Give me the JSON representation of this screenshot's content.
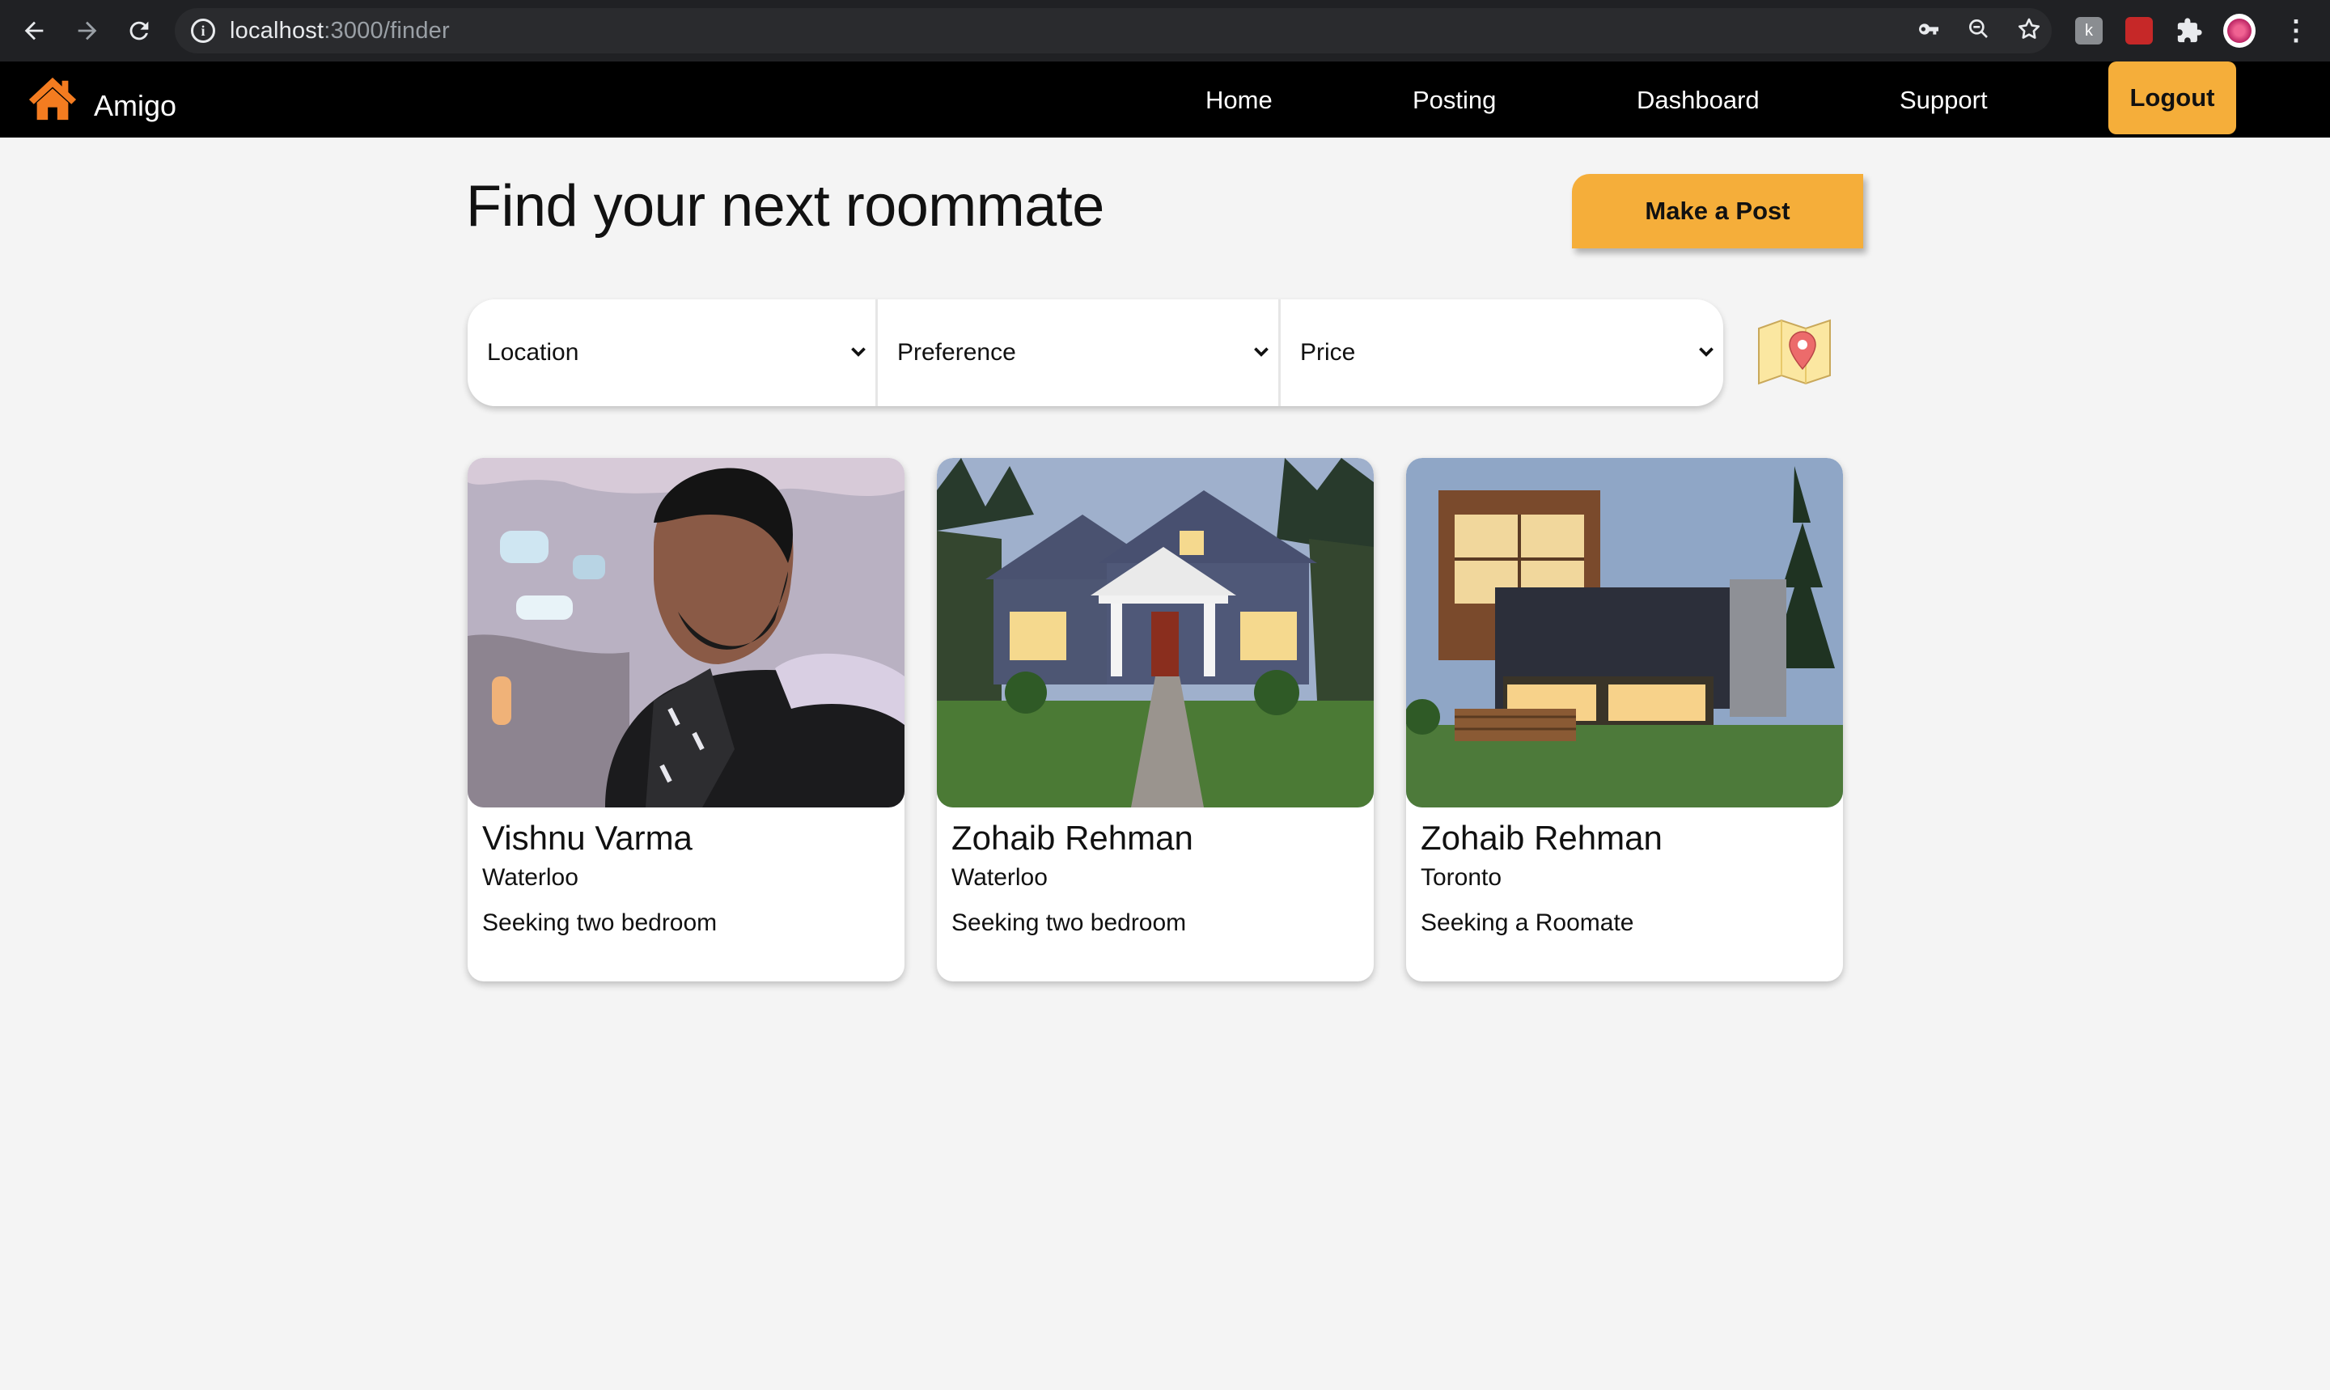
{
  "browser": {
    "url_host": "localhost",
    "url_path": ":3000/finder",
    "icons": [
      "back-arrow-icon",
      "forward-arrow-icon",
      "reload-icon",
      "site-info-icon",
      "key-icon",
      "zoom-out-icon",
      "bookmark-star-icon",
      "extension-a-icon",
      "extension-b-icon",
      "puzzle-icon",
      "profile-avatar-icon",
      "more-vert-icon"
    ]
  },
  "navbar": {
    "brand_name": "Amigo",
    "brand_icon": "house-icon",
    "brand_color": "#f47c20",
    "links": [
      "Home",
      "Posting",
      "Dashboard",
      "Support"
    ],
    "logout_label": "Logout",
    "accent_color": "#f5ae3a"
  },
  "main": {
    "title": "Find your next roommate",
    "make_post_label": "Make a Post",
    "filters": {
      "location": "Location",
      "preference": "Preference",
      "price": "Price"
    },
    "map_icon": "map-pin-icon"
  },
  "cards": [
    {
      "name": "Vishnu Varma",
      "city": "Waterloo",
      "description": "Seeking two bedroom",
      "image": "portrait-photo"
    },
    {
      "name": "Zohaib Rehman",
      "city": "Waterloo",
      "description": "Seeking two bedroom",
      "image": "house-photo"
    },
    {
      "name": "Zohaib Rehman",
      "city": "Toronto",
      "description": "Seeking a Roomate",
      "image": "modern-house-photo"
    }
  ]
}
